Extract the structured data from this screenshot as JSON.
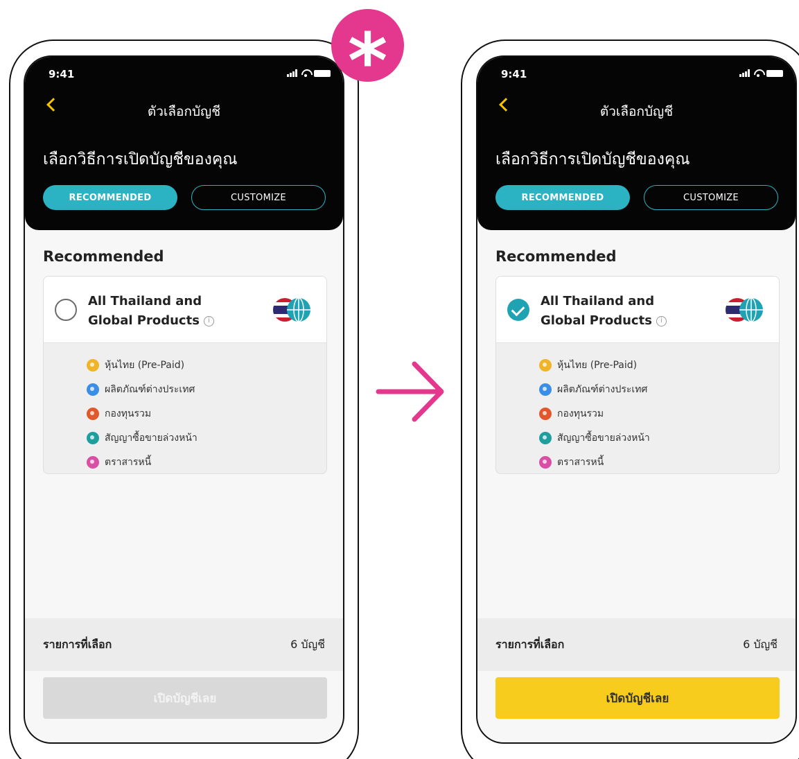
{
  "colors": {
    "accent": "#2bb3c3",
    "cta_active": "#f8cc1c",
    "cta_disabled": "#d9d9d9",
    "back_arrow": "#f5c400",
    "highlight_badge": "#e4378e",
    "change_arrow": "#e4378e"
  },
  "badge": {
    "symbol": "*",
    "icon": "asterisk-icon"
  },
  "transition": {
    "icon": "arrow-right-icon"
  },
  "screens": [
    {
      "state": "before",
      "status_time": "9:41",
      "nav_title": "ตัวเลือกบัญชี",
      "headline": "เลือกวิธีการเปิดบัญชีของคุณ",
      "tabs": {
        "recommended": "RECOMMENDED",
        "customize": "CUSTOMIZE"
      },
      "section_title": "Recommended",
      "product": {
        "name": "All Thailand and Global Products",
        "selected": false
      },
      "products": [
        {
          "label": "หุ้นไทย (Pre-Paid)",
          "color": "#f0b429"
        },
        {
          "label": "ผลิตภัณฑ์ต่างประเทศ",
          "color": "#3a8ee6"
        },
        {
          "label": "กองทุนรวม",
          "color": "#e0582b"
        },
        {
          "label": "สัญญาซื้อขายล่วงหน้า",
          "color": "#1f9e9e"
        },
        {
          "label": "ตราสารหนี้",
          "color": "#d94fa6"
        }
      ],
      "summary_label": "รายการที่เลือก",
      "summary_count": "6 บัญชี",
      "cta_label": "เปิดบัญชีเลย",
      "cta_enabled": false
    },
    {
      "state": "after",
      "status_time": "9:41",
      "nav_title": "ตัวเลือกบัญชี",
      "headline": "เลือกวิธีการเปิดบัญชีของคุณ",
      "tabs": {
        "recommended": "RECOMMENDED",
        "customize": "CUSTOMIZE"
      },
      "section_title": "Recommended",
      "product": {
        "name": "All Thailand and Global Products",
        "selected": true
      },
      "products": [
        {
          "label": "หุ้นไทย (Pre-Paid)",
          "color": "#f0b429"
        },
        {
          "label": "ผลิตภัณฑ์ต่างประเทศ",
          "color": "#3a8ee6"
        },
        {
          "label": "กองทุนรวม",
          "color": "#e0582b"
        },
        {
          "label": "สัญญาซื้อขายล่วงหน้า",
          "color": "#1f9e9e"
        },
        {
          "label": "ตราสารหนี้",
          "color": "#d94fa6"
        }
      ],
      "summary_label": "รายการที่เลือก",
      "summary_count": "6 บัญชี",
      "cta_label": "เปิดบัญชีเลย",
      "cta_enabled": true
    }
  ]
}
